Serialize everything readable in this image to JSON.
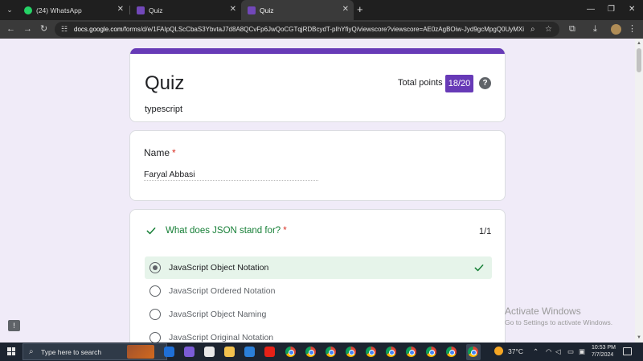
{
  "browser": {
    "tabs": [
      {
        "title": "(24) WhatsApp",
        "active": false
      },
      {
        "title": "Quiz",
        "active": false
      },
      {
        "title": "Quiz",
        "active": true
      }
    ],
    "url_host": "docs.google.com",
    "url_path": "/forms/d/e/1FAIpQLScCbaS3YbvtaJ7d8A8QCvFp6JwQoCGTqjRDBcydT-pIhYfiyQ/viewscore?viewscore=AE0zAgBOiw-Jyd9gcMpgQ0UyMXi...",
    "new_tab_symbol": "+",
    "icons": [
      "back-icon",
      "forward-icon",
      "reload-icon",
      "zoom-icon",
      "bookmark-star-icon",
      "extensions-icon",
      "download-icon",
      "kebab-menu-icon"
    ]
  },
  "form": {
    "title": "Quiz",
    "description": "typescript",
    "points_label": "Total points",
    "points_value": "18/20",
    "help_symbol": "?",
    "name_question": {
      "label": "Name",
      "required_mark": "*",
      "answer": "Faryal Abbasi"
    },
    "question1": {
      "text": "What does JSON stand for?",
      "required_mark": "*",
      "score": "1/1",
      "options": [
        {
          "label": "JavaScript Object Notation",
          "selected": true,
          "correct": true
        },
        {
          "label": "JavaScript Ordered Notation",
          "selected": false,
          "correct": false
        },
        {
          "label": "JavaScript Object Naming",
          "selected": false,
          "correct": false
        },
        {
          "label": "JavaScript Original Notation",
          "selected": false,
          "correct": false
        }
      ]
    },
    "accent_color": "#673ab7",
    "correct_color": "#188038",
    "correct_bg": "#e6f4ea"
  },
  "watermark": {
    "line1": "Activate Windows",
    "line2": "Go to Settings to activate Windows."
  },
  "taskbar": {
    "search_placeholder": "Type here to search",
    "weather_temp": "37°C",
    "time": "10:53 PM",
    "date": "7/7/2024"
  }
}
